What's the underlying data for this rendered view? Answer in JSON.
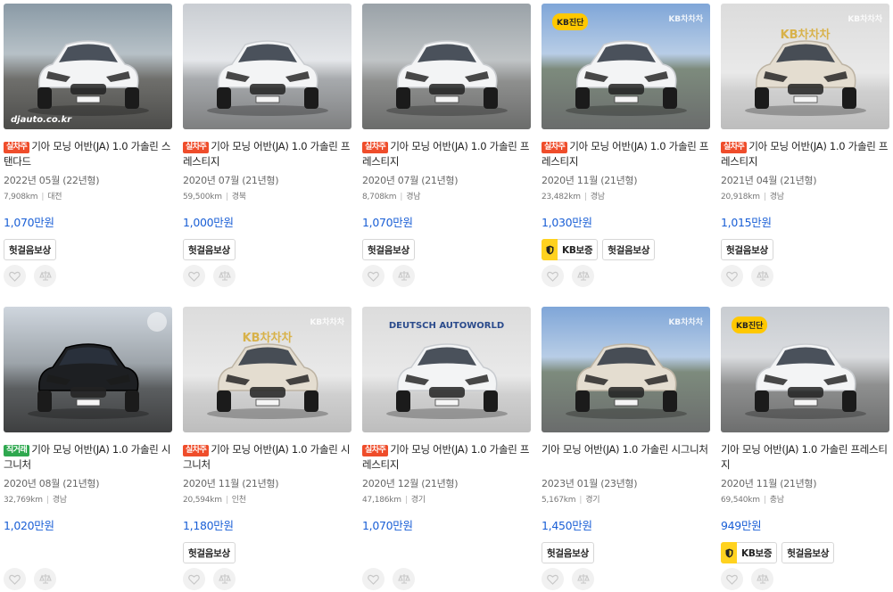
{
  "listings": [
    {
      "tag": "실차주",
      "tag_color": "red",
      "title": "기아 모닝 어반(JA) 1.0 가솔린 스탠다드",
      "year": "2022년 05월 (22년형)",
      "km": "7,908km",
      "region": "대전",
      "price": "1,070만원",
      "badges": [
        "헛걸음보상"
      ],
      "kb": false,
      "bg": "outdoor-parking",
      "car_color": "white",
      "watermark": "djauto.co.kr"
    },
    {
      "tag": "실차주",
      "tag_color": "red",
      "title": "기아 모닝 어반(JA) 1.0 가솔린 프레스티지",
      "year": "2020년 07월 (21년형)",
      "km": "59,500km",
      "region": "경북",
      "price": "1,000만원",
      "badges": [
        "헛걸음보상"
      ],
      "kb": false,
      "bg": "showroom-garage",
      "car_color": "white"
    },
    {
      "tag": "실차주",
      "tag_color": "red",
      "title": "기아 모닝 어반(JA) 1.0 가솔린 프레스티지",
      "year": "2020년 07월 (21년형)",
      "km": "8,708km",
      "region": "경남",
      "price": "1,070만원",
      "badges": [
        "헛걸음보상"
      ],
      "kb": false,
      "bg": "indoor-lot",
      "car_color": "white"
    },
    {
      "tag": "실차주",
      "tag_color": "red",
      "title": "기아 모닝 어반(JA) 1.0 가솔린 프레스티지",
      "year": "2020년 11월 (21년형)",
      "km": "23,482km",
      "region": "경남",
      "price": "1,030만원",
      "badges": [
        "KB보증",
        "헛걸음보상"
      ],
      "kb": true,
      "bg": "outdoor-sky",
      "car_color": "white",
      "kb_diag": "KB진단",
      "overlay": "KB차차차"
    },
    {
      "tag": "실차주",
      "tag_color": "red",
      "title": "기아 모닝 어반(JA) 1.0 가솔린 프레스티지",
      "year": "2021년 04월 (21년형)",
      "km": "20,918km",
      "region": "경남",
      "price": "1,015만원",
      "badges": [
        "헛걸음보상"
      ],
      "kb": false,
      "bg": "studio",
      "car_color": "beige",
      "overlay": "KB차차차",
      "logo": "KB차차차"
    },
    {
      "tag": "직거래",
      "tag_color": "green",
      "title": "기아 모닝 어반(JA) 1.0 가솔린 시그니처",
      "year": "2020년 08월 (21년형)",
      "km": "32,769km",
      "region": "경남",
      "price": "1,020만원",
      "badges": [],
      "kb": false,
      "bg": "street",
      "car_color": "black"
    },
    {
      "tag": "실차주",
      "tag_color": "red",
      "title": "기아 모닝 어반(JA) 1.0 가솔린 시그니처",
      "year": "2020년 11월 (21년형)",
      "km": "20,594km",
      "region": "인천",
      "price": "1,180만원",
      "badges": [
        "헛걸음보상"
      ],
      "kb": false,
      "bg": "studio",
      "car_color": "beige",
      "overlay": "KB차차차",
      "logo": "KB차차차"
    },
    {
      "tag": "실차주",
      "tag_color": "red",
      "title": "기아 모닝 어반(JA) 1.0 가솔린 프레스티지",
      "year": "2020년 12월 (21년형)",
      "km": "47,186km",
      "region": "경기",
      "price": "1,070만원",
      "badges": [],
      "kb": false,
      "bg": "studio",
      "car_color": "white",
      "dealer": "DEUTSCH AUTOWORLD"
    },
    {
      "tag": "",
      "tag_color": "none",
      "title": "기아 모닝 어반(JA) 1.0 가솔린 시그니처",
      "year": "2023년 01월 (23년형)",
      "km": "5,167km",
      "region": "경기",
      "price": "1,450만원",
      "badges": [
        "헛걸음보상"
      ],
      "kb": false,
      "bg": "outdoor-sky",
      "car_color": "beige",
      "overlay": "KB차차차"
    },
    {
      "tag": "",
      "tag_color": "none",
      "title": "기아 모닝 어반(JA) 1.0 가솔린 프레스티지",
      "year": "2020년 11월 (21년형)",
      "km": "69,540km",
      "region": "충남",
      "price": "949만원",
      "badges": [
        "KB보증",
        "헛걸음보상"
      ],
      "kb": true,
      "bg": "outdoor-lot",
      "car_color": "white",
      "kb_diag": "KB진단",
      "plate": "217소5195"
    }
  ],
  "colors": {
    "price": "#1a5fd6",
    "tag_red": "#ef4d2b",
    "tag_green": "#2fa84f",
    "kb_yellow": "#ffd21f"
  }
}
